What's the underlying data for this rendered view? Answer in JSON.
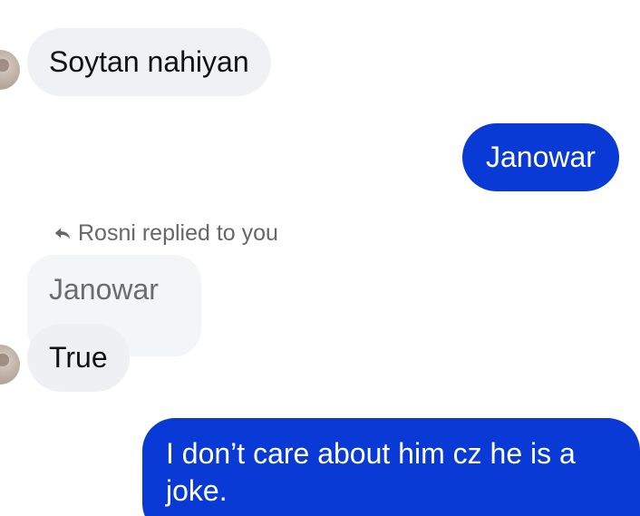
{
  "messages": [
    {
      "sender": "them",
      "text": "Soytan nahiyan"
    },
    {
      "sender": "me",
      "text": "Janowar"
    },
    {
      "sender": "them",
      "text": "True"
    },
    {
      "sender": "me",
      "text": "I don’t care about him cz he is a joke."
    }
  ],
  "reply": {
    "header": "Rosni replied to you",
    "icon": "reply-arrow-icon",
    "quoted_text": "Janowar"
  },
  "colors": {
    "outgoing_bubble": "#0a3ad6",
    "incoming_bubble": "#f0f1f5",
    "meta_text": "#65676b"
  }
}
